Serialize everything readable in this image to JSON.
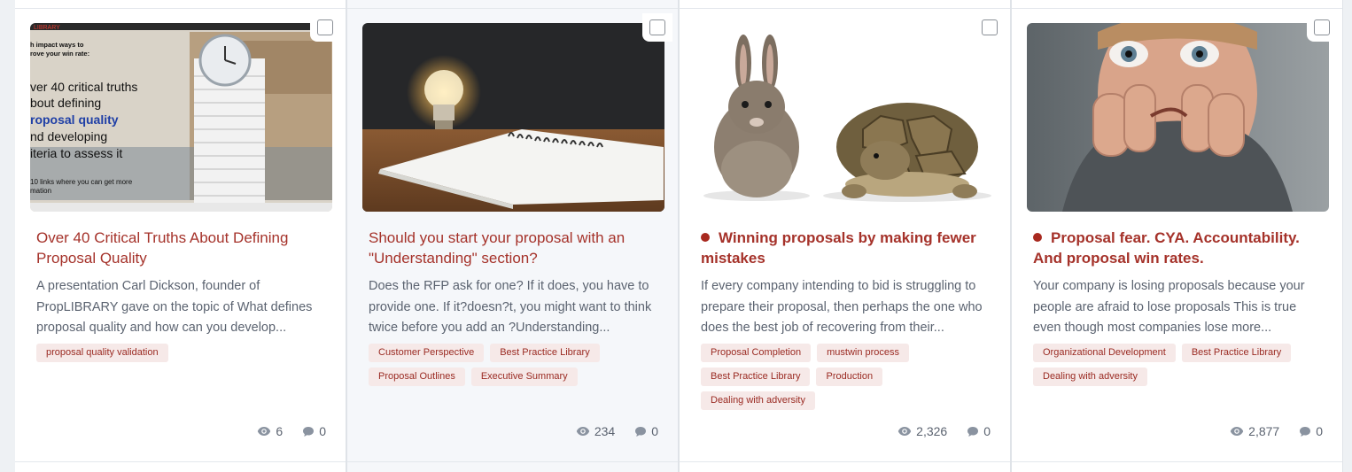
{
  "cards": [
    {
      "title": "Over 40 Critical Truths About Defining Proposal Quality",
      "description": "A presentation Carl Dickson, founder of PropLIBRARY gave on the topic of What defines proposal quality and how can you develop...",
      "tags": [
        "proposal quality validation"
      ],
      "views": "6",
      "comments": "0",
      "unread": false,
      "thumb": {
        "brand": "LIBRARY",
        "lines": [
          "h impact ways to",
          "rove your win rate:",
          "ver 40 critical truths",
          "bout defining",
          "roposal quality",
          "nd developing",
          "iteria to assess it",
          "10 links where you can get more",
          "mation"
        ]
      }
    },
    {
      "title": "Should you start your proposal with an \"Understanding\" section?",
      "description": "Does the RFP ask for one? If it does, you have to provide one. If it?doesn?t, you might want to think twice before you add an ?Understanding...",
      "tags": [
        "Customer Perspective",
        "Best Practice Library",
        "Proposal Outlines",
        "Executive Summary"
      ],
      "views": "234",
      "comments": "0",
      "unread": false
    },
    {
      "title": "Winning proposals by making fewer mistakes",
      "description": "If every company intending to bid is struggling to prepare their proposal, then perhaps the one who does the best job of recovering from their...",
      "tags": [
        "Proposal Completion",
        "mustwin process",
        "Best Practice Library",
        "Production",
        "Dealing with adversity"
      ],
      "views": "2,326",
      "comments": "0",
      "unread": true
    },
    {
      "title": "Proposal fear. CYA. Accountability. And proposal win rates.",
      "description": "Your company is losing proposals because your people are afraid to lose proposals This is true even though most companies lose more...",
      "tags": [
        "Organizational Development",
        "Best Practice Library",
        "Dealing with adversity"
      ],
      "views": "2,877",
      "comments": "0",
      "unread": true
    }
  ],
  "icons": {
    "views": "eye-icon",
    "comments": "comment-icon",
    "select": "checkbox"
  },
  "colors": {
    "accent": "#a5322a",
    "tag_bg": "#f6e9e8",
    "muted": "#5b6370"
  }
}
